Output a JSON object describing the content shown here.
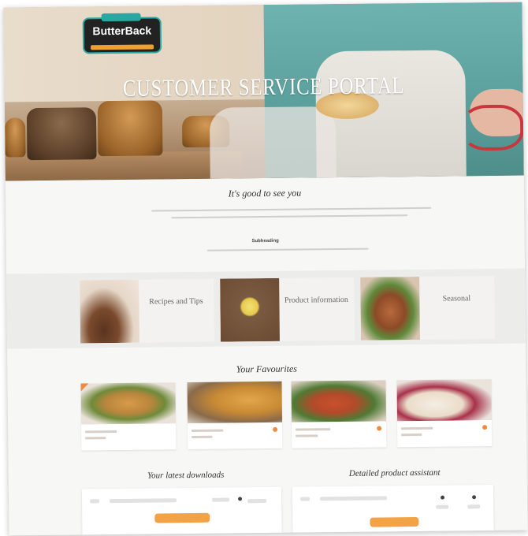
{
  "brand": {
    "name": "ButterBack"
  },
  "hero": {
    "title": "CUSTOMER SERVICE PORTAL"
  },
  "intro": {
    "title": "It's good to see you",
    "subheading": "Subheading"
  },
  "categories": [
    {
      "label": "Recipes and Tips"
    },
    {
      "label": "Product information"
    },
    {
      "label": "Seasonal"
    }
  ],
  "favourites": {
    "title": "Your Favourites"
  },
  "downloads": {
    "title": "Your latest downloads"
  },
  "assistant": {
    "title": "Detailed product assistant"
  },
  "colors": {
    "accent": "#f3a345",
    "brand_teal": "#2aa7a0",
    "band": "#ececeb"
  }
}
